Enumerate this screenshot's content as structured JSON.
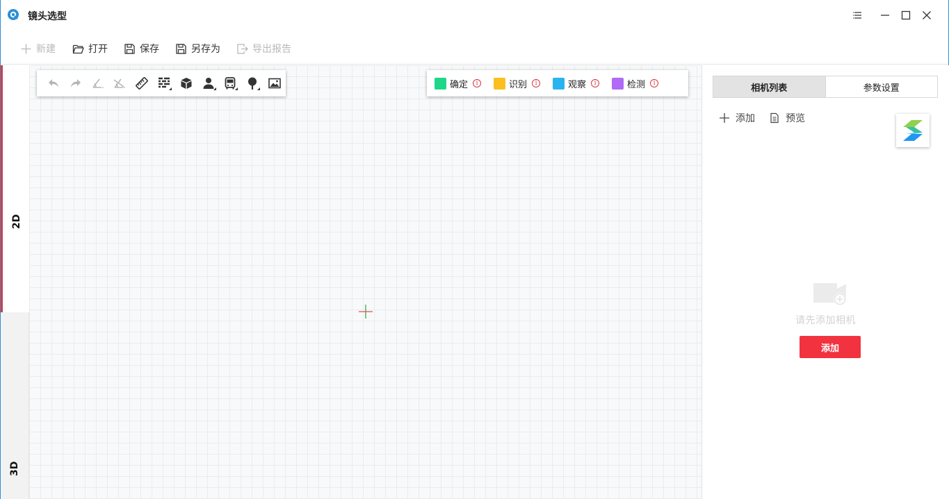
{
  "app": {
    "title": "镜头选型",
    "brand_color": "#2b8fd6",
    "icon": "lens-app-icon"
  },
  "window_controls": [
    {
      "name": "menu-icon"
    },
    {
      "name": "minimize-icon"
    },
    {
      "name": "maximize-icon"
    },
    {
      "name": "close-icon"
    }
  ],
  "toolbar": {
    "new_label": "新建",
    "open_label": "打开",
    "save_label": "保存",
    "save_as_label": "另存为",
    "export_label": "导出报告"
  },
  "view_tabs": {
    "tab_2d": "2D",
    "tab_3d": "3D",
    "active": "2D",
    "active_color": "#d93b45"
  },
  "canvas_tools": [
    {
      "name": "undo-icon",
      "enabled": false
    },
    {
      "name": "redo-icon",
      "enabled": false
    },
    {
      "name": "angle-measure-icon",
      "enabled": false
    },
    {
      "name": "angle-clear-icon",
      "enabled": false
    },
    {
      "name": "ruler-icon",
      "enabled": true
    },
    {
      "name": "wall-icon",
      "enabled": true,
      "has_submenu": true
    },
    {
      "name": "cube-icon",
      "enabled": true
    },
    {
      "name": "person-icon",
      "enabled": true,
      "has_submenu": true
    },
    {
      "name": "bus-icon",
      "enabled": true,
      "has_submenu": true
    },
    {
      "name": "tree-icon",
      "enabled": true,
      "has_submenu": true
    },
    {
      "name": "image-icon",
      "enabled": true
    }
  ],
  "legend": [
    {
      "label": "确定",
      "color": "#1ed788"
    },
    {
      "label": "识别",
      "color": "#fbbf1f"
    },
    {
      "label": "观察",
      "color": "#2ab4ef"
    },
    {
      "label": "检测",
      "color": "#b06af5"
    }
  ],
  "legend_info_glyph": "i",
  "right_panel": {
    "tab_camera_list": "相机列表",
    "tab_params": "参数设置",
    "active_tab": "相机列表",
    "add_action": "添加",
    "preview_action": "预览",
    "empty_text": "请先添加相机",
    "add_button": "添加",
    "add_button_color": "#f2323f"
  }
}
